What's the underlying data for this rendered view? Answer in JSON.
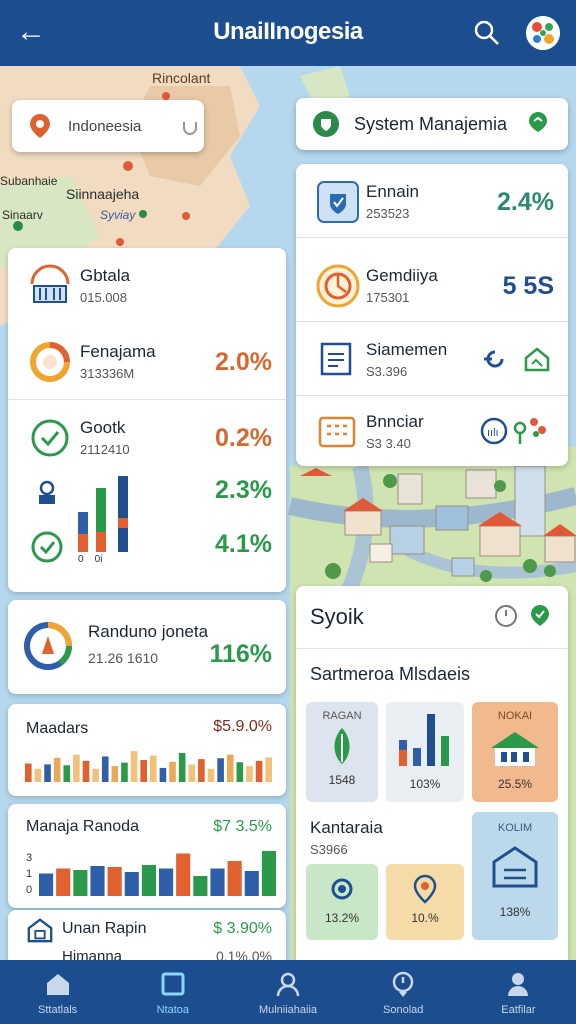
{
  "header": {
    "title": "UnaiIInogesia",
    "back_icon": "arrow-left-icon",
    "search_icon": "search-icon",
    "logo_icon": "app-logo-icon"
  },
  "map": {
    "labels": [
      "Rincolant",
      "Siinnaajeha",
      "Syviay",
      "Subanhaie",
      "Sinaarv"
    ]
  },
  "location_chip": {
    "label": "Indoneesia"
  },
  "system_chip": {
    "label": "System Manajemia"
  },
  "right_card": {
    "rows": [
      {
        "label": "Ennain",
        "sub": "253523",
        "value": "2.4%",
        "color": "#2a8a72"
      },
      {
        "label": "Gemdiiya",
        "sub": "175301",
        "value": "5 5S",
        "color": "#1f4f8f"
      },
      {
        "label": "Siamemen",
        "sub": "S3.396",
        "value": "",
        "color": "#1f4f8f"
      },
      {
        "label": "Bnnciar",
        "sub": "S3 3.40",
        "value": "",
        "color": "#1f4f8f"
      }
    ]
  },
  "left_card": {
    "rows": [
      {
        "label": "Gbtala",
        "sub": "015.008",
        "value": ""
      },
      {
        "label": "Fenajama",
        "sub": "313336M",
        "value": "2.0%",
        "color": "#d9682f"
      },
      {
        "label": "Gootk",
        "sub": "2112410",
        "value": "0.2%",
        "color": "#d9682f"
      }
    ],
    "chart_values": [
      "2.3%",
      "4.1%"
    ],
    "chart_axis": "0    0i"
  },
  "ring_card": {
    "label": "Randuno joneta",
    "sub": "21.26 1610",
    "value": "116%"
  },
  "bars_card": {
    "label": "Maadars",
    "value": "$5.9.0%",
    "bar_values": [
      0.42,
      0.3,
      0.4,
      0.55,
      0.38,
      0.62,
      0.48,
      0.3,
      0.58,
      0.36,
      0.44,
      0.7,
      0.5,
      0.6,
      0.32,
      0.46,
      0.66,
      0.4,
      0.52,
      0.3,
      0.54,
      0.62,
      0.45,
      0.36,
      0.48,
      0.56
    ]
  },
  "manaja_card": {
    "label": "Manaja Ranoda",
    "value": "$7 3.5%",
    "axis_ticks": [
      "3",
      "1",
      "0"
    ],
    "bar_values": [
      0.45,
      0.55,
      0.52,
      0.6,
      0.58,
      0.48,
      0.62,
      0.55,
      0.85,
      0.4,
      0.55,
      0.7,
      0.5,
      0.9
    ]
  },
  "urban_card": {
    "label": "Unan Rapin",
    "value": "$ 3.90%",
    "label2": "Himanna",
    "value2": "0.1%.0%"
  },
  "syoik_card": {
    "title": "Syoik",
    "section": "Sartmeroa Mlsdaeis",
    "tiles": [
      {
        "head": "RAGAN",
        "val": "1548",
        "bg": "#dde3ef"
      },
      {
        "head": "",
        "val": "103%",
        "bg": "#e9eef3"
      },
      {
        "head": "NOKAI",
        "val": "25.5%",
        "bg": "#f1b98d"
      }
    ],
    "sub_title": "Kantaraia",
    "sub_sub": "S3966",
    "tiles2": [
      {
        "val": "13.2%",
        "bg": "#c8e7c6"
      },
      {
        "val": "10.%",
        "bg": "#f5dba8"
      },
      {
        "head": "KOLIM",
        "val": "138%",
        "bg": "#bcd9ec"
      }
    ]
  },
  "nav": [
    {
      "label": "Sttatlals",
      "icon": "home-icon",
      "active": false
    },
    {
      "label": "Ntatoa",
      "icon": "square-icon",
      "active": true
    },
    {
      "label": "Mulniiahaiia",
      "icon": "user-icon",
      "active": false
    },
    {
      "label": "Sonolad",
      "icon": "pin-icon",
      "active": false
    },
    {
      "label": "Eatfilar",
      "icon": "person-icon",
      "active": false
    }
  ]
}
